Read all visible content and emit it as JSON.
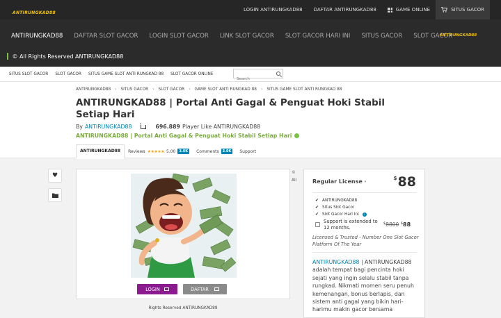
{
  "brand": {
    "logo_text": "ANTIRUNGKAD88",
    "accent": "#f2c200",
    "nav_bg": "#2b2b2b",
    "purple": "#8b1b8f",
    "link_blue": "#0084b4",
    "green": "#79a93f"
  },
  "topbar": {
    "login": "LOGIN ANTIRUNGKAD88",
    "daftar": "DAFTAR ANTIRUNGKAD88",
    "game_online": "GAME ONLINE",
    "situs_gacor": "SITUS GACOR"
  },
  "nav": {
    "items": [
      "ANTIRUNGKAD88",
      "DAFTAR SLOT GACOR",
      "LOGIN SLOT GACOR",
      "LINK SLOT GACOR",
      "SLOT GACOR HARI INI",
      "SITUS GACOR",
      "SLOT GACOR"
    ],
    "rights": "© All Rights Reserved ANTIRUNGKAD88"
  },
  "subnav": {
    "items": [
      "SITUS SLOT GACOR",
      "SLOT GACOR",
      "SITUS GAME SLOT ANTI RUNGKAD 88",
      "SLOT GACOR ONLINE"
    ],
    "search_placeholder": "Search"
  },
  "breadcrumb": [
    "ANTIRUNGKAD88",
    "SITUS GACOR",
    "SLOT GACOR",
    "GAME SLOT ANTI RUNGKAD 88",
    "SITUS GAME SLOT ANTI RUNGKAD 88"
  ],
  "title": "ANTIRUNGKAD88 | Portal Anti Gagal & Penguat Hoki Stabil Setiap Hari",
  "byline": {
    "by": "By",
    "author": "ANTIRUNGKAD88",
    "count": "696.889",
    "suffix": "Player Like ANTIRUNGKAD88"
  },
  "subtitle": "ANTIRUNGKAD88 | Portal Anti Gagal & Penguat Hoki Stabil Setiap Hari",
  "tabs": {
    "active": "ANTIRUNGKAD88",
    "reviews": "Reviews",
    "stars": "★★★★★",
    "rating": "5.00",
    "reviews_badge": "3.0K",
    "comments": "Comments",
    "comments_badge": "3.0K",
    "support": "Support"
  },
  "preview": {
    "login_label": "LOGIN",
    "daftar_label": "DAFTAR",
    "caption": "Rights Reserved ANTIRUNGKAD88",
    "side_fragment_1": "©",
    "side_fragment_2": "All"
  },
  "license": {
    "label": "Regular License",
    "currency": "$",
    "price": "88",
    "features": [
      "ANTIRUNGKAD88",
      "Situs Slot Gacor",
      "Slot Gacor Hari Ini"
    ],
    "support_text": "Support is extended to 12 months.",
    "old_price": "8800",
    "new_price": "88",
    "note": "Licensed & Trusted - Number One Slot Gacor Platform Of The Year",
    "desc_link": "ANTIRUNGKAD88",
    "desc_rest": " | ANTIRUNGKAD88 adalah tempat bagi pencinta hoki sejati yang ingin selalu stabil tanpa rungkad. Nikmati momen seru penuh kemenangan, bonus berlapis, dan sistem anti gagal yang bikin hari-harimu makin gacor bersama"
  }
}
